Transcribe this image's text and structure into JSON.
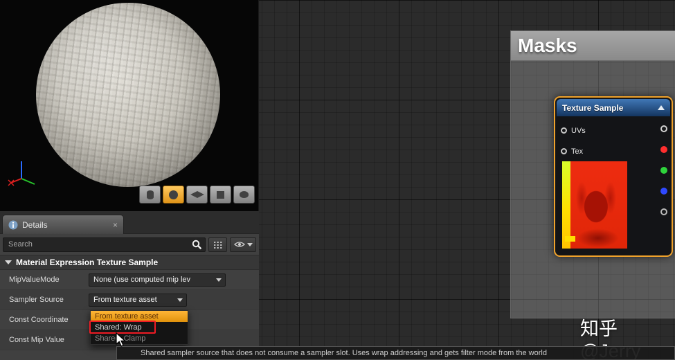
{
  "preview": {
    "toolbar": [
      {
        "name": "cylinder-primitive",
        "active": false
      },
      {
        "name": "sphere-primitive",
        "active": true
      },
      {
        "name": "plane-primitive",
        "active": false
      },
      {
        "name": "cube-primitive",
        "active": false
      },
      {
        "name": "teapot-primitive",
        "active": false
      }
    ]
  },
  "details": {
    "tab_label": "Details",
    "search_placeholder": "Search",
    "section_header": "Material Expression Texture Sample",
    "rows": [
      {
        "label": "MipValueMode",
        "value": "None (use computed mip lev"
      },
      {
        "label": "Sampler Source",
        "value": "From texture asset"
      },
      {
        "label": "Const Coordinate",
        "value": ""
      },
      {
        "label": "Const Mip Value",
        "value": ""
      }
    ],
    "dropdown_options": [
      {
        "label": "From texture asset",
        "selected": true
      },
      {
        "label": "Shared: Wrap",
        "annotated": true
      },
      {
        "label": "Shared: Clamp",
        "selected": false
      }
    ]
  },
  "graph": {
    "comment_title": "Masks",
    "node": {
      "title": "Texture Sample",
      "inputs": [
        {
          "label": "UVs"
        },
        {
          "label": "Tex"
        }
      ],
      "outputs": [
        {
          "name": "rgb",
          "style": "border-color:#cfcfcf;background:#17181a"
        },
        {
          "name": "r",
          "style": "border-color:#ff2e2e;background:#ff2e2e"
        },
        {
          "name": "g",
          "style": "border-color:#2fd43c;background:#2fd43c"
        },
        {
          "name": "b",
          "style": "border-color:#2f49ff;background:#2f49ff"
        },
        {
          "name": "a",
          "style": "border-color:#b9b9b9;background:#17181a"
        }
      ]
    }
  },
  "status": {
    "tooltip": "Shared sampler source that does not consume a sampler slot.  Uses wrap addressing and gets filter mode from the world"
  },
  "watermark": "知乎 @Jerry",
  "colors": {
    "selection_orange": "#f0a22b",
    "node_header_blue": "#3d74b4",
    "highlight_orange": "#e0920c",
    "annotation_red": "#ef1b24",
    "pin_red": "#ff2e2e",
    "pin_green": "#2fd43c",
    "pin_blue": "#2f49ff"
  },
  "icons": {
    "tab-close-icon": "×",
    "search-magnifier-icon": "magnifier",
    "grid-view-icon": "grid-dots",
    "visibility-eye-icon": "eye",
    "expander-triangle-icon": "triangle-down",
    "node-collapse-icon": "triangle-up",
    "axis-gizmo-icon": "xyz-axes",
    "cursor-icon": "arrow-pointer"
  }
}
